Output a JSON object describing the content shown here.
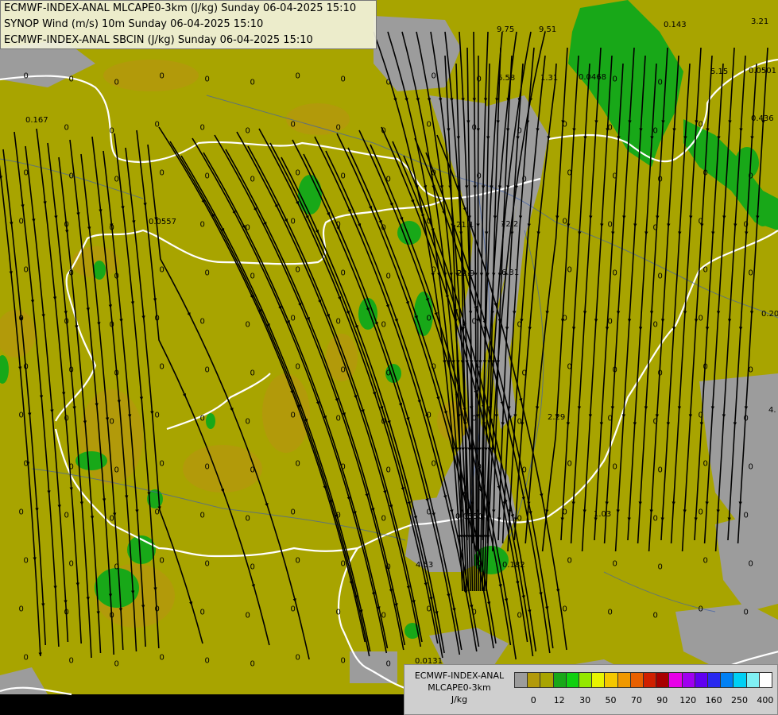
{
  "header": {
    "line1": "ECMWF-INDEX-ANAL MLCAPE0-3km (J/kg) Sunday 06-04-2025 15:10",
    "line2": "SYNOP Wind (m/s) 10m Sunday 06-04-2025 15:10",
    "line3": "ECMWF-INDEX-ANAL SBCIN (J/kg) Sunday 06-04-2025 15:10"
  },
  "legend": {
    "title1": "ECMWF-INDEX-ANAL",
    "title2": "MLCAPE0-3km",
    "unit": "J/kg",
    "colors": [
      "#9c9c9c",
      "#b29a0a",
      "#a8a400",
      "#18a818",
      "#10d010",
      "#94e800",
      "#e8f400",
      "#f4c800",
      "#f09800",
      "#e86000",
      "#d02000",
      "#a80000",
      "#e800e8",
      "#a000f0",
      "#6000f0",
      "#2828f0",
      "#0080f4",
      "#00d0f4",
      "#80f0f4",
      "#ffffff"
    ],
    "ticks": [
      "0",
      "12",
      "30",
      "50",
      "70",
      "90",
      "120",
      "160",
      "250",
      "400"
    ]
  },
  "map_labels": [
    {
      "id": "l1",
      "text": "9.75"
    },
    {
      "id": "l2",
      "text": "9.51"
    },
    {
      "id": "l3",
      "text": "0.143"
    },
    {
      "id": "l4",
      "text": "3.21"
    },
    {
      "id": "l5",
      "text": "6.58"
    },
    {
      "id": "l6",
      "text": "1.31"
    },
    {
      "id": "l7",
      "text": "0.0468"
    },
    {
      "id": "l8",
      "text": "5.15"
    },
    {
      "id": "l9",
      "text": "0.0501"
    },
    {
      "id": "l10",
      "text": "0.167"
    },
    {
      "id": "l11",
      "text": "0.436"
    },
    {
      "id": "l12",
      "text": "21.1"
    },
    {
      "id": "l13",
      "text": "12.2"
    },
    {
      "id": "l14",
      "text": "22.9"
    },
    {
      "id": "l15",
      "text": "6.31"
    },
    {
      "id": "l16",
      "text": "0.20"
    },
    {
      "id": "l17",
      "text": "2.29"
    },
    {
      "id": "l18",
      "text": "4."
    },
    {
      "id": "l19",
      "text": "0.0550"
    },
    {
      "id": "l20",
      "text": "1.03"
    },
    {
      "id": "l21",
      "text": "4.53"
    },
    {
      "id": "l22",
      "text": "0.182"
    },
    {
      "id": "l23",
      "text": "0.0131"
    },
    {
      "id": "l24",
      "text": "0.0557"
    },
    {
      "id": "l25",
      "text": "0"
    }
  ]
}
